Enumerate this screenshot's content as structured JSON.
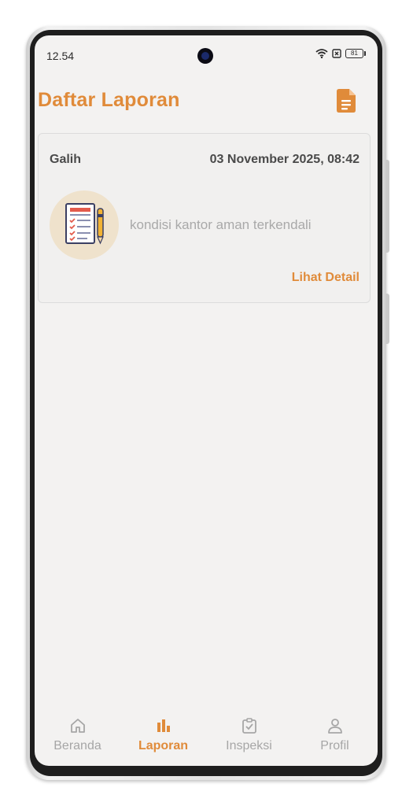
{
  "status_bar": {
    "time": "12.54",
    "battery": "81"
  },
  "header": {
    "title": "Daftar Laporan",
    "action_icon": "document-icon"
  },
  "reports": [
    {
      "reporter": "Galih",
      "datetime": "03 November 2025, 08:42",
      "description": "kondisi kantor aman terkendali",
      "thumbnail_icon": "checklist-clipboard-icon",
      "detail_label": "Lihat Detail"
    }
  ],
  "bottom_nav": {
    "items": [
      {
        "label": "Beranda",
        "icon": "home-icon",
        "active": false
      },
      {
        "label": "Laporan",
        "icon": "bar-chart-icon",
        "active": true
      },
      {
        "label": "Inspeksi",
        "icon": "clipboard-check-icon",
        "active": false
      },
      {
        "label": "Profil",
        "icon": "person-icon",
        "active": false
      }
    ]
  },
  "colors": {
    "accent": "#e08b3a",
    "screen_background": "#f3f2f1",
    "inactive": "#a6a6a6"
  }
}
